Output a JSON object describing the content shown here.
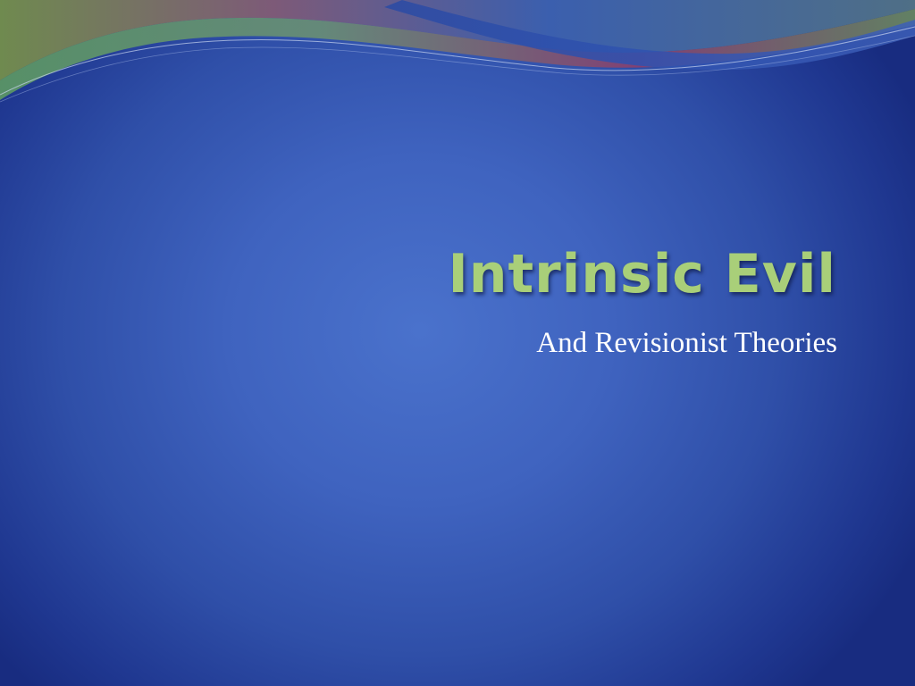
{
  "slide": {
    "title": "Intrinsic Evil",
    "subtitle": "And Revisionist Theories"
  },
  "theme": {
    "background_center": "#4a72cc",
    "background_edge": "#182c80",
    "title_color": "#a9cf79",
    "subtitle_color": "#ffffff",
    "wave_colors": [
      "#8a3f6e",
      "#5f8f6a",
      "#2e4ea8",
      "#6b7fc4"
    ]
  }
}
